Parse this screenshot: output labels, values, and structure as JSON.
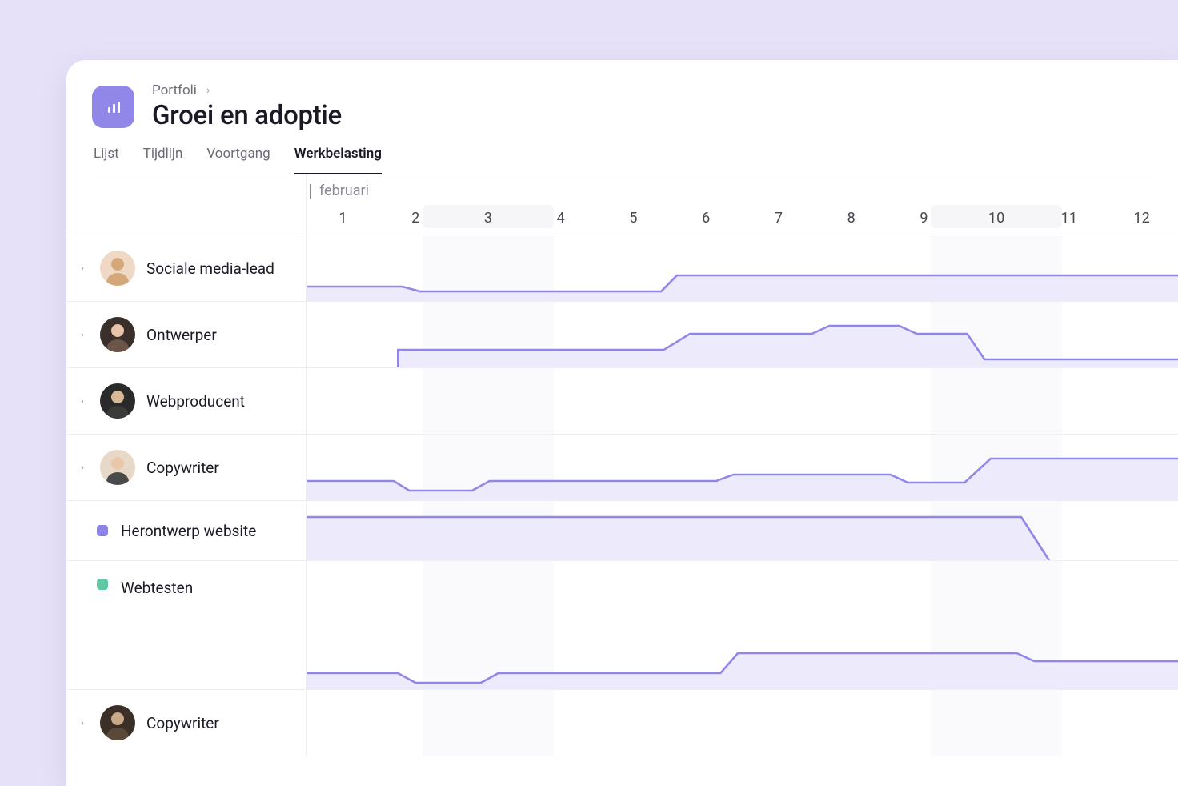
{
  "breadcrumb": {
    "label": "Portfoli"
  },
  "page_title": "Groei en adoptie",
  "tabs": [
    {
      "label": "Lijst",
      "active": false
    },
    {
      "label": "Tijdlijn",
      "active": false
    },
    {
      "label": "Voortgang",
      "active": false
    },
    {
      "label": "Werkbelasting",
      "active": true
    }
  ],
  "timeline": {
    "month": "februari",
    "days": [
      "1",
      "2",
      "3",
      "4",
      "5",
      "6",
      "7",
      "8",
      "9",
      "10",
      "11",
      "12"
    ],
    "weekend_ranges": [
      [
        2,
        3
      ],
      [
        9,
        10
      ]
    ]
  },
  "rows": [
    {
      "type": "person",
      "label": "Sociale media-lead",
      "avatar_bg": "#f0d9c4",
      "expandable": true
    },
    {
      "type": "person",
      "label": "Ontwerper",
      "avatar_bg": "#d9c9b8",
      "expandable": true
    },
    {
      "type": "person",
      "label": "Webproducent",
      "avatar_bg": "#e8d5c9",
      "expandable": true
    },
    {
      "type": "person",
      "label": "Copywriter",
      "avatar_bg": "#f2e4d6",
      "expandable": true
    },
    {
      "type": "project",
      "label": "Herontwerp website",
      "color": "#8c83e6"
    },
    {
      "type": "project",
      "label": "Webtesten",
      "color": "#5fc9a7"
    },
    {
      "type": "person",
      "label": "Copywriter",
      "avatar_bg": "#e0cdb8",
      "expandable": true
    }
  ],
  "colors": {
    "accent": "#9187e8",
    "fill": "#edeafb"
  }
}
